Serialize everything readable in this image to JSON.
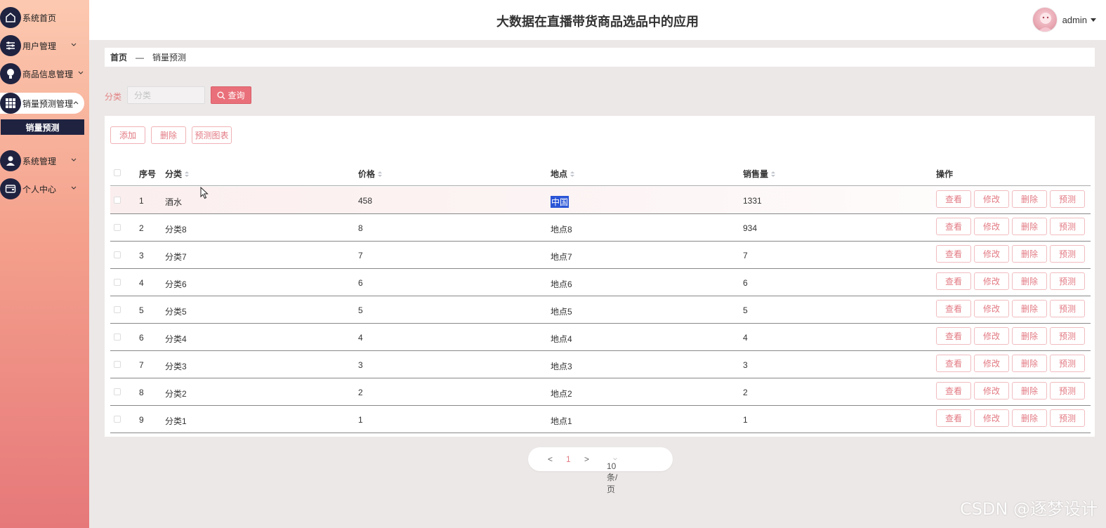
{
  "header": {
    "title": "大数据在直播带货商品选品中的应用",
    "username": "admin"
  },
  "sidebar": {
    "items": [
      {
        "label": "系统首页",
        "icon": "home-icon"
      },
      {
        "label": "用户管理",
        "icon": "sliders-icon"
      },
      {
        "label": "商品信息管理",
        "icon": "bulb-icon"
      },
      {
        "label": "销量预测管理",
        "icon": "grid-icon"
      },
      {
        "label": "系统管理",
        "icon": "user-icon"
      },
      {
        "label": "个人中心",
        "icon": "wallet-icon"
      }
    ],
    "subitem": "销量预测"
  },
  "breadcrumb": {
    "home": "首页",
    "sep": "—",
    "current": "销量预测"
  },
  "search": {
    "label": "分类",
    "placeholder": "分类",
    "button": "查询"
  },
  "toolbar": {
    "add": "添加",
    "delete": "删除",
    "chart": "预测图表"
  },
  "table": {
    "headers": {
      "index": "序号",
      "category": "分类",
      "price": "价格",
      "location": "地点",
      "sales": "销售量",
      "actions": "操作"
    },
    "actions": {
      "view": "查看",
      "edit": "修改",
      "delete": "删除",
      "predict": "预测"
    },
    "rows": [
      {
        "index": "1",
        "category": "酒水",
        "price": "458",
        "location": "中国",
        "sales": "1331"
      },
      {
        "index": "2",
        "category": "分类8",
        "price": "8",
        "location": "地点8",
        "sales": "934"
      },
      {
        "index": "3",
        "category": "分类7",
        "price": "7",
        "location": "地点7",
        "sales": "7"
      },
      {
        "index": "4",
        "category": "分类6",
        "price": "6",
        "location": "地点6",
        "sales": "6"
      },
      {
        "index": "5",
        "category": "分类5",
        "price": "5",
        "location": "地点5",
        "sales": "5"
      },
      {
        "index": "6",
        "category": "分类4",
        "price": "4",
        "location": "地点4",
        "sales": "4"
      },
      {
        "index": "7",
        "category": "分类3",
        "price": "3",
        "location": "地点3",
        "sales": "3"
      },
      {
        "index": "8",
        "category": "分类2",
        "price": "2",
        "location": "地点2",
        "sales": "2"
      },
      {
        "index": "9",
        "category": "分类1",
        "price": "1",
        "location": "地点1",
        "sales": "1"
      }
    ]
  },
  "pagination": {
    "prev": "<",
    "page": "1",
    "next": ">",
    "size": "10条/页"
  },
  "watermark": "CSDN @逐梦设计",
  "colors": {
    "accent": "#e9707a",
    "navy": "#1f2340",
    "selection": "#2a55d6"
  }
}
